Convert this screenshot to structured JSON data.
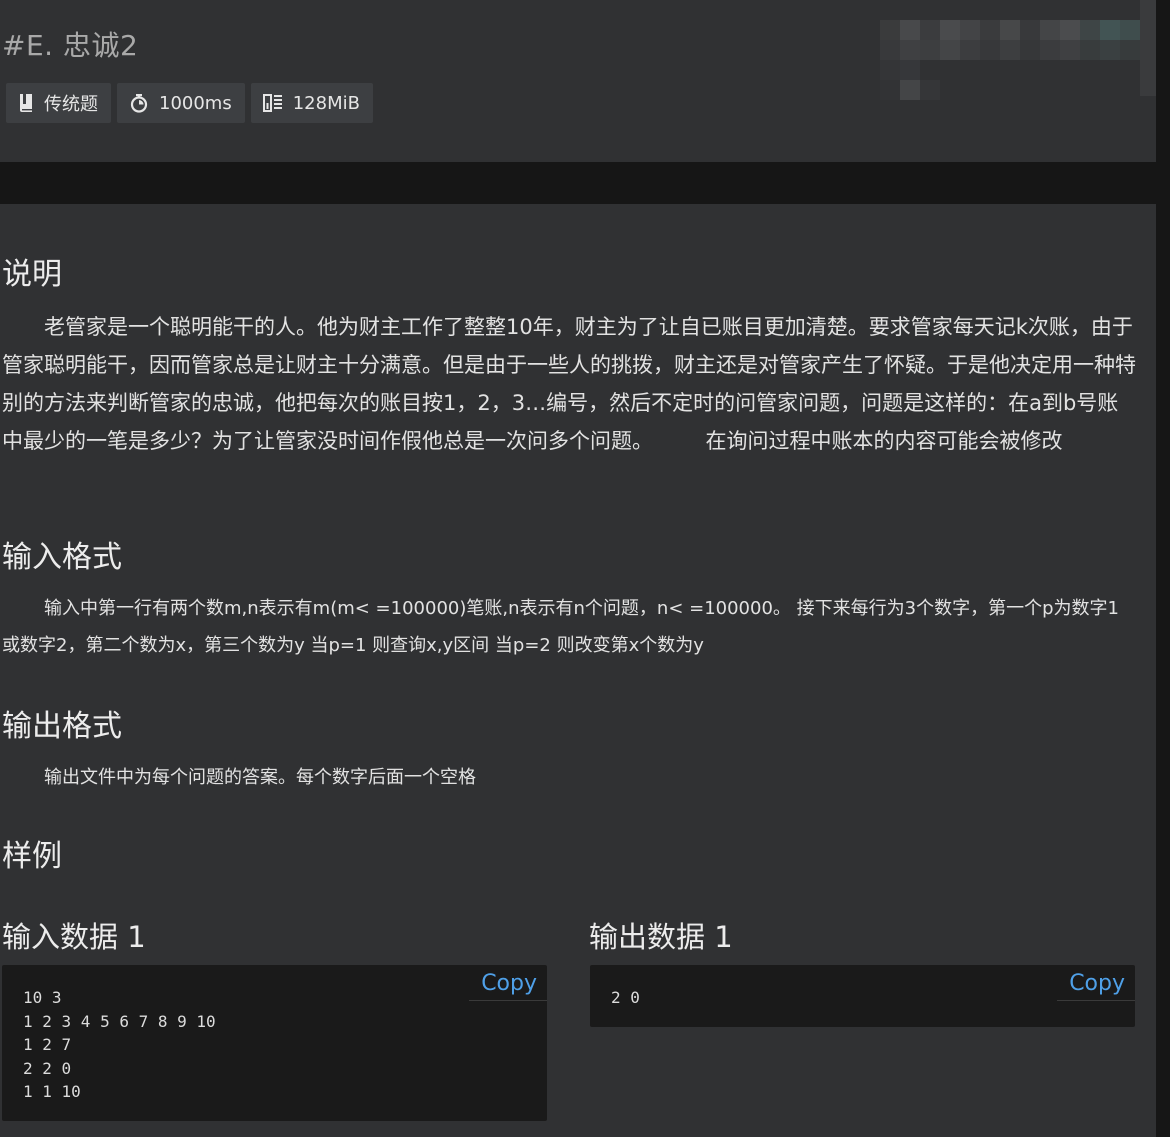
{
  "header": {
    "title": "#E. 忠诚2",
    "tags": [
      {
        "icon": "book-icon",
        "label": "传统题"
      },
      {
        "icon": "stopwatch-icon",
        "label": "1000ms"
      },
      {
        "icon": "memory-icon",
        "label": "128MiB"
      }
    ]
  },
  "sections": {
    "description": {
      "heading": "说明",
      "text": "老管家是一个聪明能干的人。他为财主工作了整整10年，财主为了让自已账目更加清楚。要求管家每天记k次账，由于管家聪明能干，因而管家总是让财主十分满意。但是由于一些人的挑拨，财主还是对管家产生了怀疑。于是他决定用一种特别的方法来判断管家的忠诚，他把每次的账目按1，2，3…编号，然后不定时的问管家问题，问题是这样的：在a到b号账中最少的一笔是多少？为了让管家没时间作假他总是一次问多个问题。　　　在询问过程中账本的内容可能会被修改"
    },
    "input_format": {
      "heading": "输入格式",
      "text": "输入中第一行有两个数m,n表示有m(m< =100000)笔账,n表示有n个问题，n< =100000。 接下来每行为3个数字，第一个p为数字1或数字2，第二个数为x，第三个数为y 当p=1 则查询x,y区间 当p=2 则改变第x个数为y"
    },
    "output_format": {
      "heading": "输出格式",
      "text": "输出文件中为每个问题的答案。每个数字后面一个空格"
    },
    "samples": {
      "heading": "样例",
      "input": {
        "heading": "输入数据 1",
        "copy_label": "Copy",
        "content": "10 3\n1 2 3 4 5 6 7 8 9 10\n1 2 7\n2 2 0\n1 1 10"
      },
      "output": {
        "heading": "输出数据 1",
        "copy_label": "Copy",
        "content": "2 0"
      }
    }
  },
  "colors": {
    "page_background": "#161616",
    "card_background": "#303133",
    "tag_background": "#3d3f42",
    "code_background": "#1a1a1a",
    "link": "#4fa0e8",
    "title_text": "#a9a9a9"
  }
}
